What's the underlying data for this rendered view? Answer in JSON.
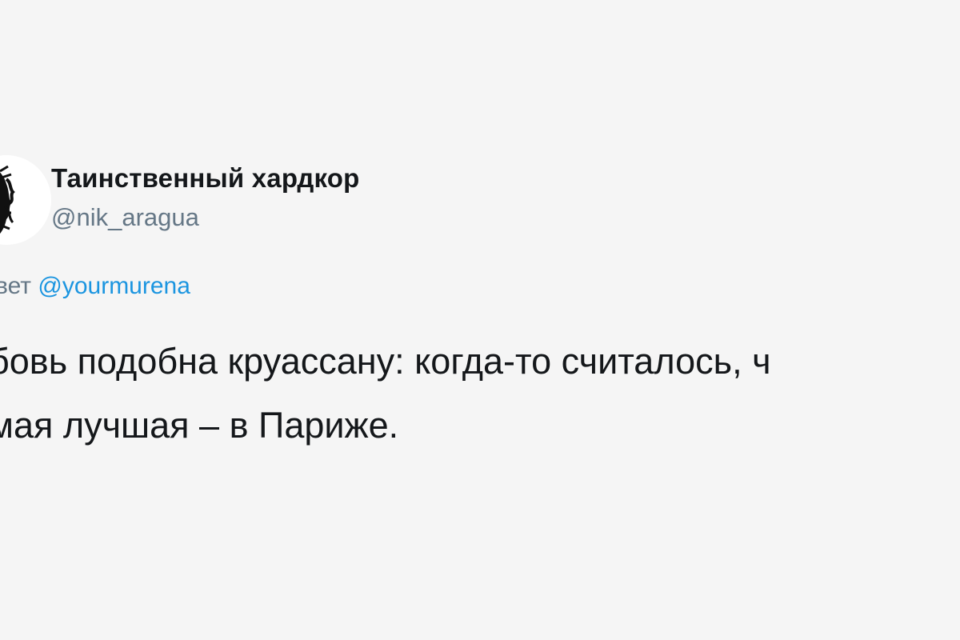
{
  "author": {
    "display_name": "Таинственный хардкор",
    "handle": "@nik_aragua",
    "avatar_icon": "avatar-silhouette-icon"
  },
  "reply": {
    "prefix": "вет",
    "mention": "@yourmurena"
  },
  "tweet": {
    "lines": [
      "бовь подобна круассану: когда-то считалось, ч",
      "мая лучшая – в Париже."
    ]
  },
  "colors": {
    "background": "#f5f5f5",
    "text": "#14171a",
    "secondary": "#657786",
    "link": "#1b95e0"
  }
}
